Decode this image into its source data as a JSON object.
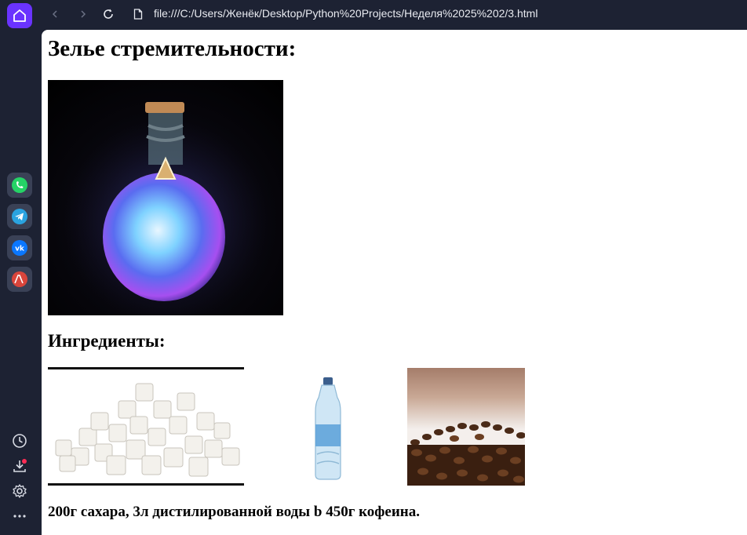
{
  "browser": {
    "address": "file:///C:/Users/Женёк/Desktop/Python%20Projects/Неделя%2025%202/3.html",
    "accent_color": "#6a33ff"
  },
  "sidebar": {
    "apps": [
      {
        "name": "whatsapp-icon",
        "color": "#25d366"
      },
      {
        "name": "telegram-icon",
        "color": "#2aa3e0"
      },
      {
        "name": "vk-icon",
        "color": "#0a77ff"
      },
      {
        "name": "translate-icon",
        "color": "#d9453b"
      }
    ]
  },
  "page": {
    "title": "Зелье стремительности:",
    "ingredients_heading": "Ингредиенты:",
    "caption": "200г сахара, 3л дистилированной воды b 450г кофеина."
  }
}
